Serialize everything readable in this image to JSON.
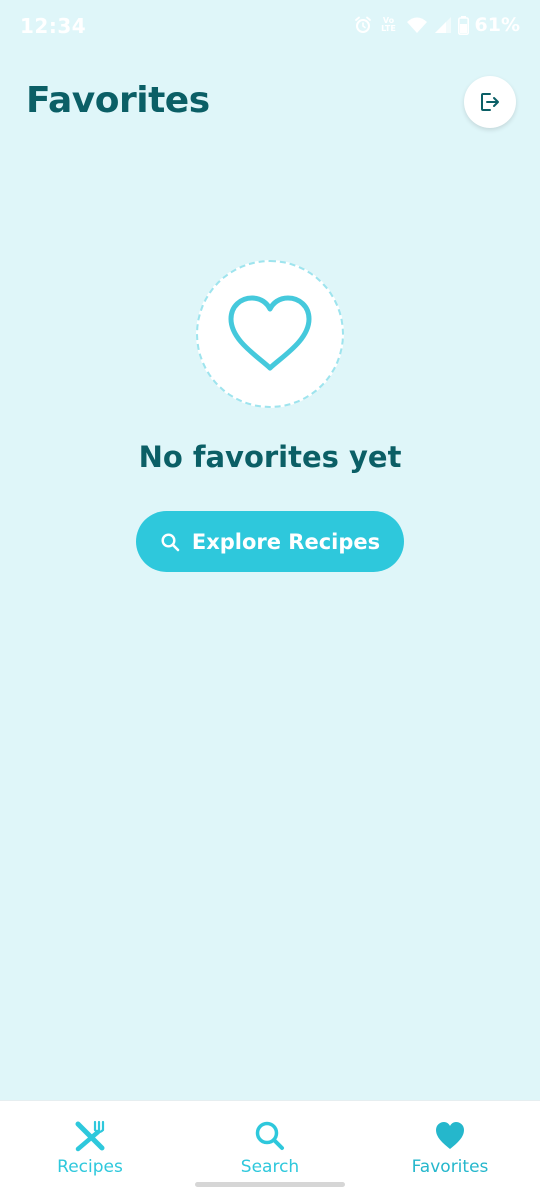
{
  "status_bar": {
    "time": "12:34",
    "network_label": "Vo LTE",
    "battery_percent": "61%"
  },
  "header": {
    "title": "Favorites",
    "logout_icon": "logout-icon"
  },
  "empty_state": {
    "icon": "heart-outline-icon",
    "title": "No favorites yet",
    "button_label": "Explore Recipes",
    "button_icon": "search-icon"
  },
  "bottom_nav": {
    "items": [
      {
        "label": "Recipes",
        "icon": "utensils-icon",
        "active": false
      },
      {
        "label": "Search",
        "icon": "search-icon",
        "active": false
      },
      {
        "label": "Favorites",
        "icon": "heart-icon",
        "active": true
      }
    ]
  },
  "colors": {
    "background": "#dff6f9",
    "accent": "#2ec8dc",
    "title_text": "#0b5f66",
    "white": "#ffffff"
  }
}
